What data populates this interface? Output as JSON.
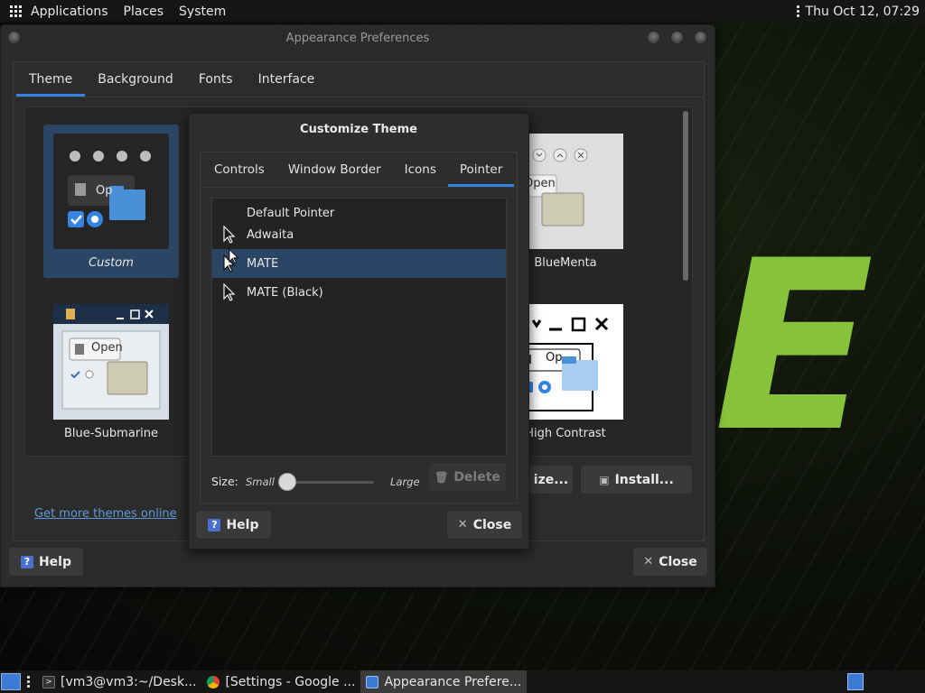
{
  "top_panel": {
    "menus": [
      "Applications",
      "Places",
      "System"
    ],
    "clock": "Thu Oct 12, 07:29"
  },
  "window": {
    "title": "Appearance Preferences",
    "tabs": [
      "Theme",
      "Background",
      "Fonts",
      "Interface"
    ],
    "active_tab": "Theme",
    "themes": [
      {
        "label": "Custom",
        "selected": true
      },
      {
        "label": "BlueMenta",
        "selected": false
      },
      {
        "label": "Blue-Submarine",
        "selected": false
      },
      {
        "label": "High Contrast",
        "selected": false
      }
    ],
    "customize_label": "ize...",
    "install_label": "Install...",
    "get_more_link": "Get more themes online",
    "help_label": "Help",
    "close_label": "Close"
  },
  "thumb_text": {
    "open": "Open",
    "open_partial": "Op"
  },
  "dialog": {
    "title": "Customize Theme",
    "tabs": [
      "Controls",
      "Window Border",
      "Icons",
      "Pointer"
    ],
    "active_tab": "Pointer",
    "pointers": [
      {
        "label": "Default Pointer",
        "icon": "none",
        "selected": false
      },
      {
        "label": "Adwaita",
        "icon": "cursor-arrow-icon",
        "selected": false
      },
      {
        "label": "MATE",
        "icon": "cursor-arrow-icon",
        "selected": true
      },
      {
        "label": "MATE (Black)",
        "icon": "cursor-arrow-icon",
        "selected": false
      }
    ],
    "size_label": "Size:",
    "size_small": "Small",
    "size_large": "Large",
    "delete_label": "Delete",
    "help_label": "Help",
    "close_label": "Close"
  },
  "taskbar": {
    "tasks": [
      {
        "label": "[vm3@vm3:~/Desk...",
        "icon": "terminal-icon"
      },
      {
        "label": "[Settings - Google ...",
        "icon": "chrome-icon"
      },
      {
        "label": "Appearance Prefere...",
        "icon": "appearance-icon"
      }
    ]
  },
  "colors": {
    "accent": "#3584e4",
    "selection": "#2b4564",
    "desktop_logo": "#87c33a"
  },
  "desktop_logo_text": "E"
}
